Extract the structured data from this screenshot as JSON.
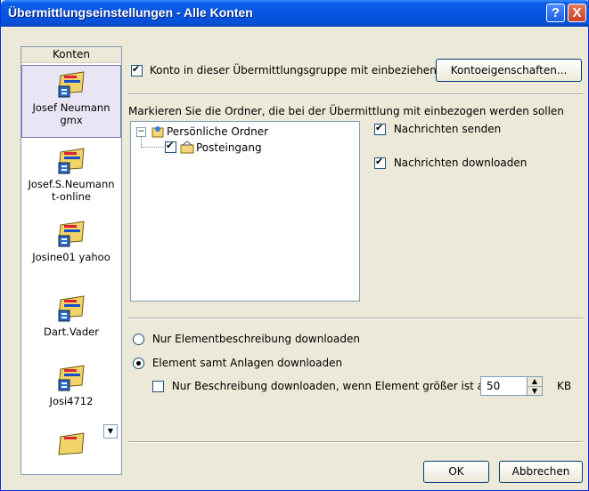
{
  "window": {
    "title": "Übermittlungseinstellungen - Alle Konten",
    "help_label": "?",
    "close_label": "X"
  },
  "sidebar": {
    "header": "Konten",
    "accounts": [
      {
        "line1": "Josef Neumann",
        "line2": "gmx",
        "selected": true
      },
      {
        "line1": "Josef.S.Neumann",
        "line2": "t-online"
      },
      {
        "line1": "Josine01 yahoo",
        "line2": ""
      },
      {
        "line1": "Dart.Vader",
        "line2": ""
      },
      {
        "line1": "Josi4712",
        "line2": ""
      }
    ],
    "scroll_down": "▼"
  },
  "main": {
    "include_label": "Konto in dieser Übermittlungsgruppe mit einbeziehen",
    "include_checked": true,
    "account_props_button": "Kontoeigenschaften...",
    "folders_instruction": "Markieren Sie die Ordner, die bei der Übermittlung mit einbezogen werden sollen",
    "tree": {
      "root": "Persönliche Ordner",
      "expander": "−",
      "child": "Posteingang",
      "child_checked": true
    },
    "send_label": "Nachrichten senden",
    "send_checked": true,
    "download_label": "Nachrichten downloaden",
    "download_checked": true,
    "radio_headers_only": "Nur Elementbeschreibung downloaden",
    "radio_full": "Element samt Anlagen downloaden",
    "selected_radio": "full",
    "size_limit_label": "Nur Beschreibung downloaden, wenn Element größer ist als",
    "size_limit_checked": false,
    "size_value": "50",
    "size_unit": "KB"
  },
  "footer": {
    "ok": "OK",
    "cancel": "Abbrechen"
  }
}
